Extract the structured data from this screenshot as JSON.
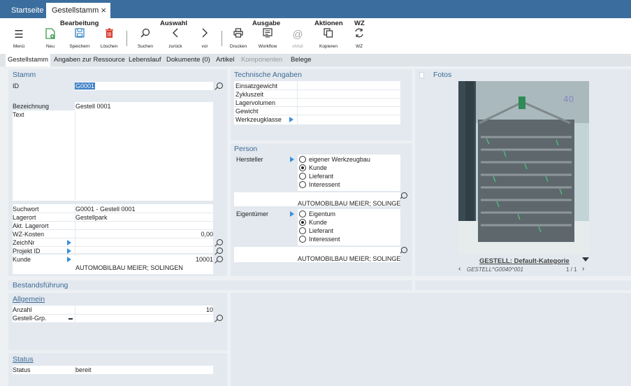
{
  "tabs": {
    "home": "Startseite",
    "active": "Gestellstamm",
    "close": "×"
  },
  "ribbon": {
    "groups": {
      "bearbeitung": "Bearbeitung",
      "auswahl": "Auswahl",
      "ausgabe": "Ausgabe",
      "aktionen": "Aktionen",
      "wz": "WZ"
    },
    "buttons": {
      "menu": "Menü",
      "new": "Neu",
      "save": "Speichern",
      "delete": "Löschen",
      "search": "Suchen",
      "back": "zurück",
      "forward": "vor",
      "print": "Drucken",
      "workflow": "Workflow",
      "email": "eMail",
      "copy": "Kopieren",
      "wz": "WZ"
    }
  },
  "subtabs": [
    "Gestellstamm",
    "Angaben zur Ressource",
    "Lebenslauf",
    "Dokumente (0)",
    "Artikel",
    "Komponenten",
    "Belege"
  ],
  "stamm": {
    "title": "Stamm",
    "id_label": "ID",
    "id_value": "G0001",
    "bezeichnung_label": "Bezeichnung",
    "bezeichnung_value": "Gestell 0001",
    "text_label": "Text",
    "suchwort_label": "Suchwort",
    "suchwort_value": "G0001 - Gestell 0001",
    "lagerort_label": "Lagerort",
    "lagerort_value": "Gestellpark",
    "akt_lagerort_label": "Akt. Lagerort",
    "wz_kosten_label": "WZ-Kosten",
    "wz_kosten_value": "0,00",
    "zeichnr_label": "ZeichNr",
    "projekt_label": "Projekt ID",
    "kunde_label": "Kunde",
    "kunde_value": "10001",
    "kunde_name": "AUTOMOBILBAU MEIER; SOLINGEN"
  },
  "technik": {
    "title": "Technische Angaben",
    "einsatzgewicht": "Einsatzgewicht",
    "zykluszeit": "Zykluszeit",
    "lagervolumen": "Lagervolumen",
    "gewicht": "Gewicht",
    "werkzeugklasse": "Werkzeugklasse"
  },
  "person": {
    "title": "Person",
    "hersteller_label": "Hersteller",
    "hersteller_options": [
      "eigener Werkzeugbau",
      "Kunde",
      "Lieferant",
      "Interessent"
    ],
    "hersteller_selected": 1,
    "hersteller_name": "AUTOMOBILBAU MEIER; SOLINGEN",
    "eigentuemer_label": "Eigentümer",
    "eigentuemer_options": [
      "Eigentum",
      "Kunde",
      "Lieferant",
      "Interessent"
    ],
    "eigentuemer_selected": 1,
    "eigentuemer_name": "AUTOMOBILBAU MEIER; SOLINGEN"
  },
  "fotos": {
    "title": "Fotos",
    "photo_marking": "40",
    "category": "GESTELL: Default-Kategorie",
    "path": "GESTELL^G0040^001",
    "pager": "1 / 1"
  },
  "bestand": {
    "title": "Bestandsführung"
  },
  "allgemein": {
    "title": "Allgemein",
    "anzahl_label": "Anzahl",
    "anzahl_value": "10",
    "gruppe_label": "Gestell-Grp."
  },
  "status": {
    "title": "Status",
    "label": "Status",
    "value": "bereit"
  },
  "colors": {
    "titlebar": "#3b6e9e",
    "panel": "#e3e9ef",
    "heading": "#3d6a94",
    "arrow": "#3b8fd8",
    "delete": "#d9372a",
    "new": "#3a9a4a",
    "save": "#2f7fc4"
  }
}
